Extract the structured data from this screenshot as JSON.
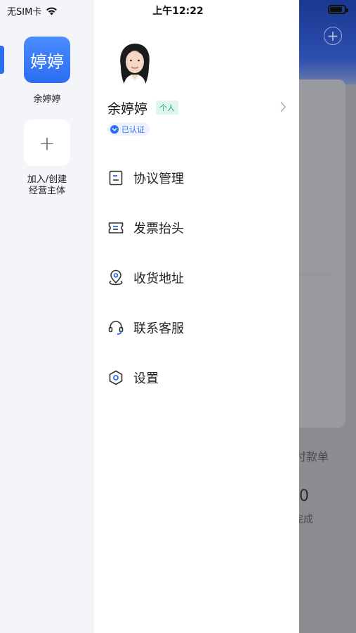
{
  "status_bar": {
    "carrier": "无SIM卡",
    "time": "上午12:22",
    "battery_level": 0.85
  },
  "rail": {
    "entity_avatar_text": "婷婷",
    "entity_name": "余婷婷",
    "add_label_line1": "加入/创建",
    "add_label_line2": "经营主体",
    "add_symbol": "+"
  },
  "profile": {
    "name": "余婷婷",
    "tag": "个人",
    "verified": "已认证"
  },
  "menu": [
    {
      "label": "协议管理",
      "icon": "document-icon"
    },
    {
      "label": "发票抬头",
      "icon": "ticket-icon"
    },
    {
      "label": "收货地址",
      "icon": "location-icon"
    },
    {
      "label": "联系客服",
      "icon": "headset-icon"
    },
    {
      "label": "设置",
      "icon": "settings-hexagon-icon"
    }
  ],
  "background": {
    "text1": "付款单",
    "number": "0",
    "text2": "完成"
  },
  "colors": {
    "accent": "#2c6ef2",
    "tag_green": "#1fa37a"
  }
}
